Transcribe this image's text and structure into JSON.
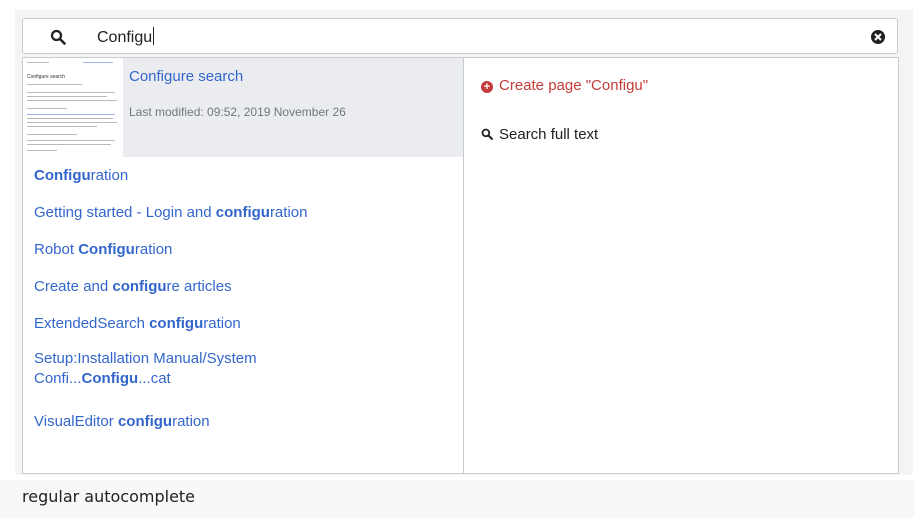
{
  "search": {
    "query": "Configu"
  },
  "top_result": {
    "title": "Configure search",
    "meta": "Last modified: 09:52, 2019 November 26",
    "thumbnail_title": "Configure search"
  },
  "results": [
    {
      "pre": "",
      "bold": "Configu",
      "post": "ration"
    },
    {
      "pre": "Getting started - Login and ",
      "bold": "configu",
      "post": "ration"
    },
    {
      "pre": "Robot ",
      "bold": "Configu",
      "post": "ration"
    },
    {
      "pre": "Create and ",
      "bold": "configu",
      "post": "re articles"
    },
    {
      "pre": "ExtendedSearch ",
      "bold": "configu",
      "post": "ration"
    },
    {
      "pre": "Setup:Installation Manual/System",
      "line2_pre": "Confi...",
      "bold": "Configu",
      "post": "...cat"
    },
    {
      "pre": "VisualEditor ",
      "bold": "configu",
      "post": "ration"
    }
  ],
  "actions": {
    "create_page": "Create page \"Configu\"",
    "search_full_text": "Search full text"
  },
  "caption": "regular autocomplete",
  "colors": {
    "link": "#3366cc",
    "create": "#c33c39",
    "highlight_bg": "#eaecf0",
    "border": "#c8ccd1"
  }
}
